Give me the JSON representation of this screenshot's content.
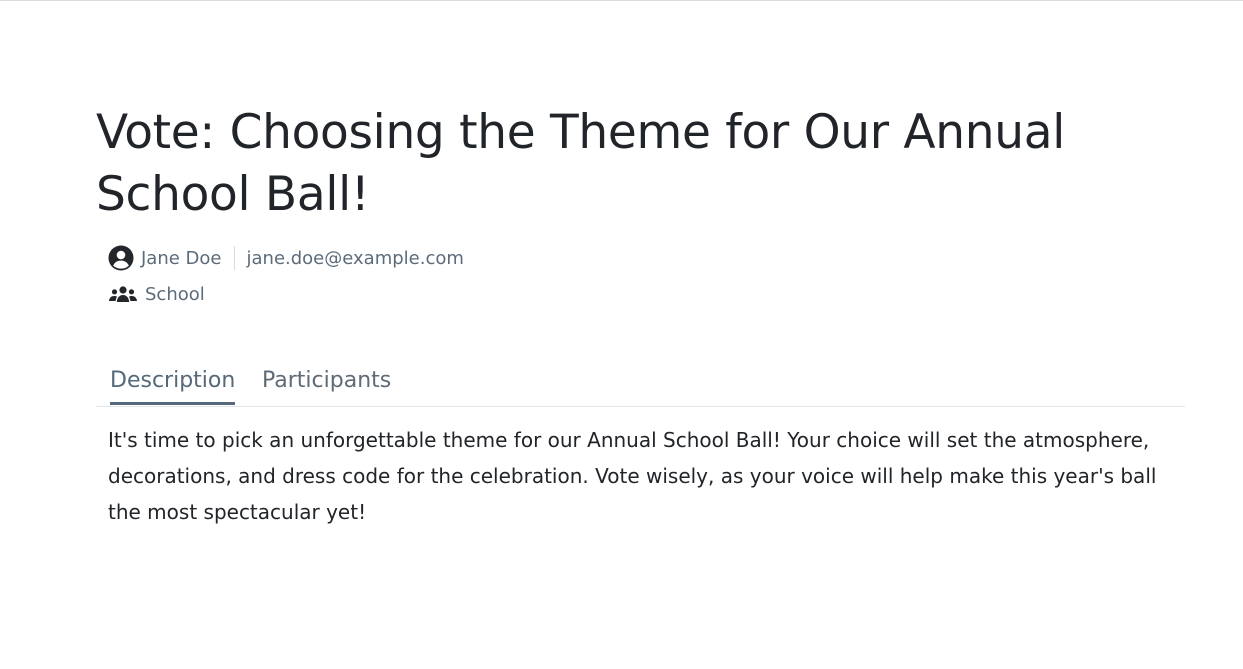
{
  "poll": {
    "title": "Vote: Choosing the Theme for Our Annual School Ball!",
    "author": {
      "name": "Jane Doe",
      "email": "jane.doe@example.com",
      "icon": "user-circle-icon"
    },
    "group": {
      "name": "School",
      "icon": "users-group-icon"
    }
  },
  "tabs": {
    "items": [
      {
        "label": "Description",
        "active": true
      },
      {
        "label": "Participants",
        "active": false
      }
    ]
  },
  "description": {
    "text": "It's time to pick an unforgettable theme for our Annual School Ball! Your choice will set the atmosphere, decorations, and dress code for the celebration. Vote wisely, as your voice will help make this year's ball the most spectacular yet!"
  },
  "colors": {
    "text": "#212529",
    "muted": "#5c6c7a",
    "accent": "#55697a",
    "divider": "#e3e6e9"
  }
}
